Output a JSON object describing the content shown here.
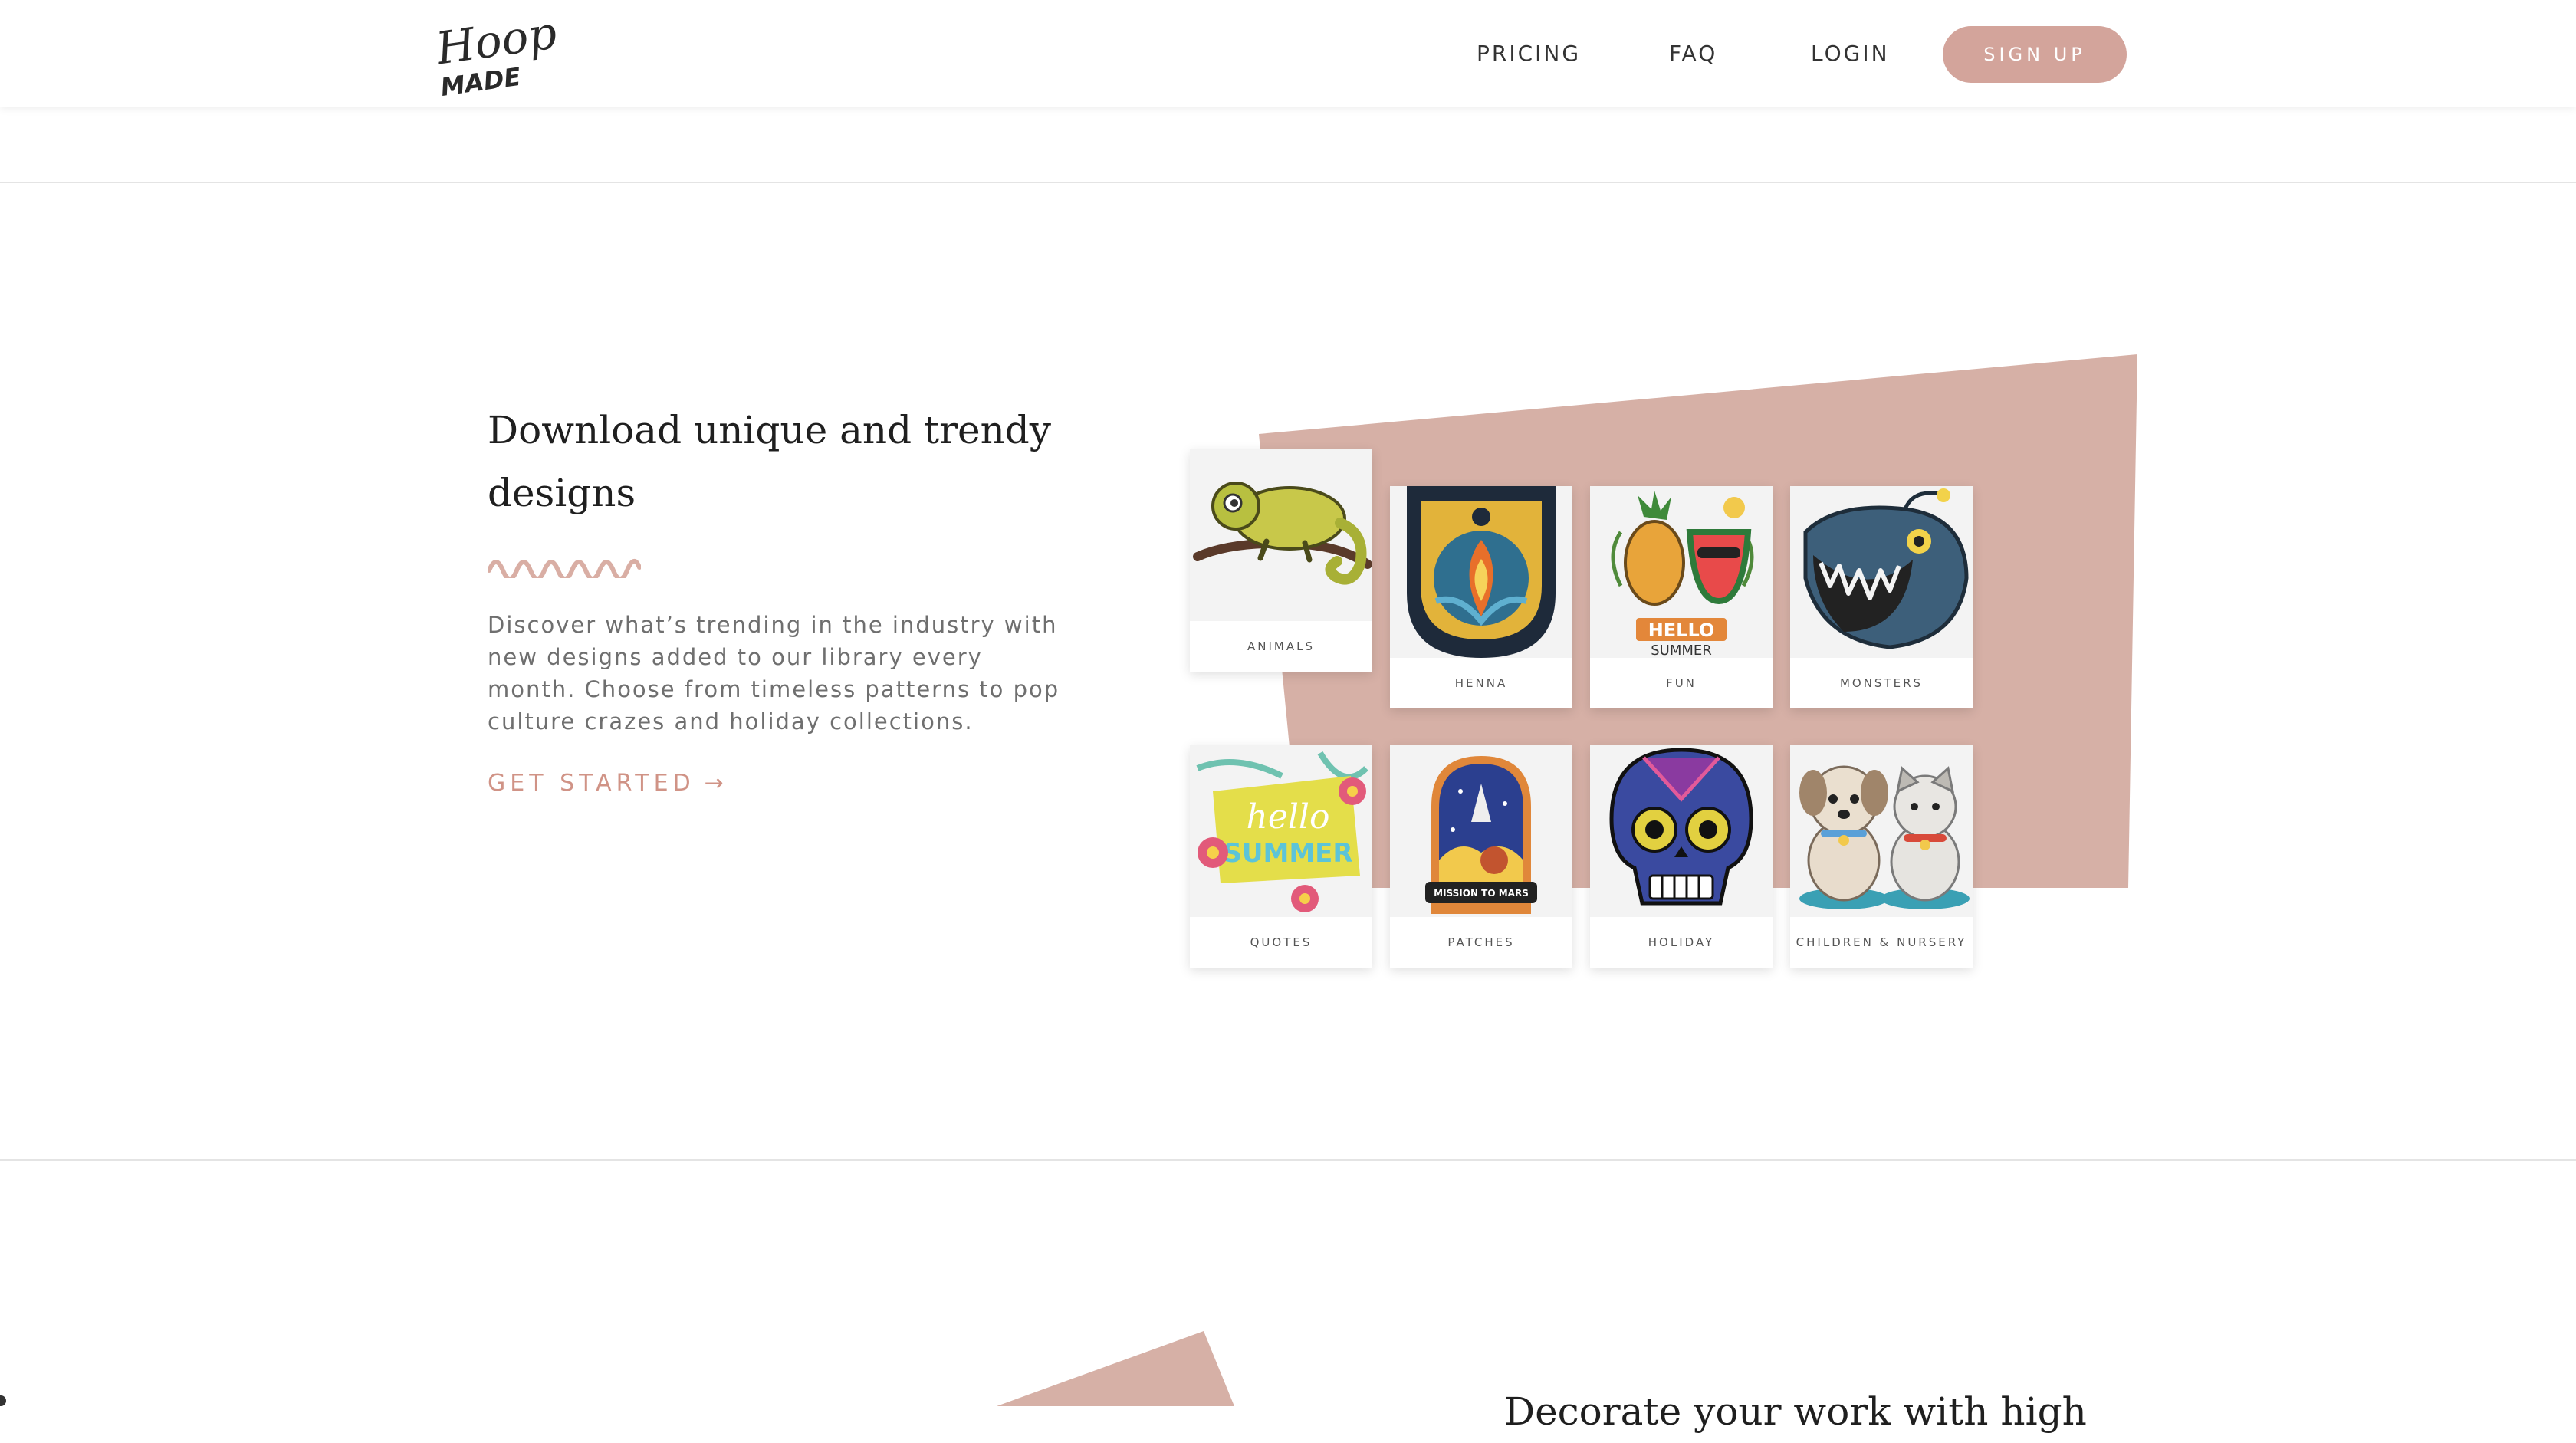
{
  "brand": {
    "logo_top": "Hoop",
    "logo_bottom": "MADE",
    "accent": "#d3a49b",
    "cta_color": "#d09386"
  },
  "nav": {
    "links": [
      "PRICING",
      "FAQ",
      "LOGIN"
    ],
    "signup_label": "SIGN UP"
  },
  "hero": {
    "headline": "Download unique and trendy designs",
    "description": "Discover what’s trending in the industry with new designs added to our library every month. Choose from timeless patterns to pop culture crazes and holiday collections.",
    "cta_label": "GET STARTED",
    "cta_arrow": "→"
  },
  "categories": [
    {
      "label": "ANIMALS",
      "icon": "chameleon-design"
    },
    {
      "label": "HENNA",
      "icon": "hamsa-design"
    },
    {
      "label": "FUN",
      "icon": "pineapple-watermelon-design",
      "art_text": [
        "HELLO",
        "SUMMER"
      ]
    },
    {
      "label": "MONSTERS",
      "icon": "anglerfish-design"
    },
    {
      "label": "QUOTES",
      "icon": "hello-summer-quote-design",
      "art_text": [
        "hello",
        "SUMMER"
      ]
    },
    {
      "label": "PATCHES",
      "icon": "mission-to-mars-patch-design",
      "art_text": [
        "MISSION TO MARS"
      ]
    },
    {
      "label": "HOLIDAY",
      "icon": "sugar-skull-design"
    },
    {
      "label": "CHILDREN & NURSERY",
      "icon": "puppy-kitten-design"
    }
  ],
  "next_section": {
    "heading_partial": "Decorate your work with high"
  }
}
